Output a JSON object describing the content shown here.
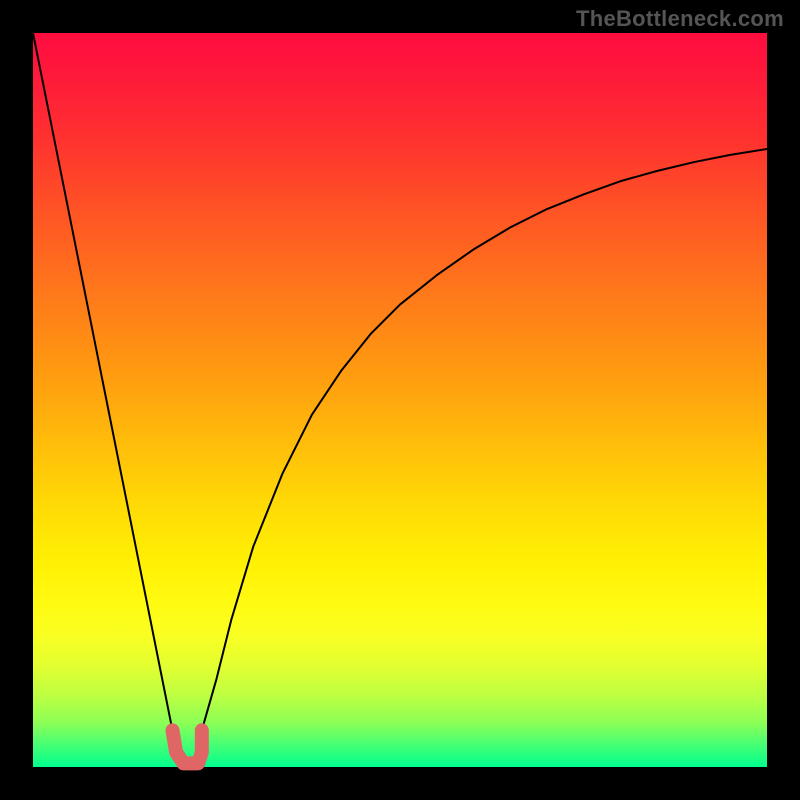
{
  "watermark": "TheBottleneck.com",
  "chart_data": {
    "type": "line",
    "title": "",
    "xlabel": "",
    "ylabel": "",
    "xlim": [
      0,
      100
    ],
    "ylim": [
      0,
      100
    ],
    "grid": false,
    "series": [
      {
        "name": "curve",
        "x": [
          0,
          2,
          4,
          6,
          8,
          10,
          12,
          14,
          16,
          18,
          19,
          20,
          21,
          22,
          23,
          25,
          27,
          30,
          34,
          38,
          42,
          46,
          50,
          55,
          60,
          65,
          70,
          75,
          80,
          85,
          90,
          95,
          100
        ],
        "y": [
          100,
          90,
          80,
          70,
          60,
          50,
          40,
          30,
          20,
          10,
          5,
          1,
          0,
          1,
          5,
          12,
          20,
          30,
          40,
          48,
          54,
          59,
          63,
          67,
          70.5,
          73.5,
          76,
          78,
          79.8,
          81.2,
          82.4,
          83.4,
          84.2
        ]
      },
      {
        "name": "highlight-bracket",
        "x": [
          19,
          19.5,
          20.5,
          22.5,
          23,
          23
        ],
        "y": [
          5,
          2,
          0.5,
          0.5,
          2,
          5
        ]
      }
    ],
    "colors": {
      "gradient_top": "#ff0c3f",
      "gradient_bottom": "#00ff8e",
      "curve": "#000000",
      "bracket": "#e06666"
    }
  }
}
